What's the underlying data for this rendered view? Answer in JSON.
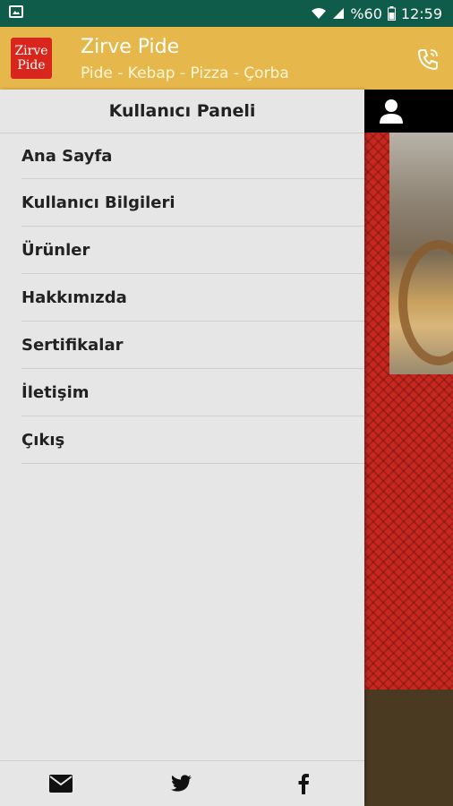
{
  "status_bar": {
    "battery_text": "%60",
    "time": "12:59"
  },
  "app_bar": {
    "logo_line1": "Zirve",
    "logo_line2": "Pide",
    "title": "Zirve Pide",
    "subtitle": "Pide - Kebap - Pizza - Çorba"
  },
  "drawer": {
    "header": "Kullanıcı Paneli",
    "items": [
      {
        "label": "Ana Sayfa"
      },
      {
        "label": "Kullanıcı Bilgileri"
      },
      {
        "label": "Ürünler"
      },
      {
        "label": "Hakkımızda"
      },
      {
        "label": "Sertifikalar"
      },
      {
        "label": "İletişim"
      },
      {
        "label": "Çıkış"
      }
    ],
    "footer_icons": [
      "mail-icon",
      "twitter-icon",
      "facebook-icon"
    ]
  },
  "colors": {
    "status_bar": "#0f5c4a",
    "app_bar": "#e6b84c",
    "logo_bg": "#d9261c",
    "drawer_bg": "#e6e6e6",
    "content_red": "#c3221a"
  }
}
